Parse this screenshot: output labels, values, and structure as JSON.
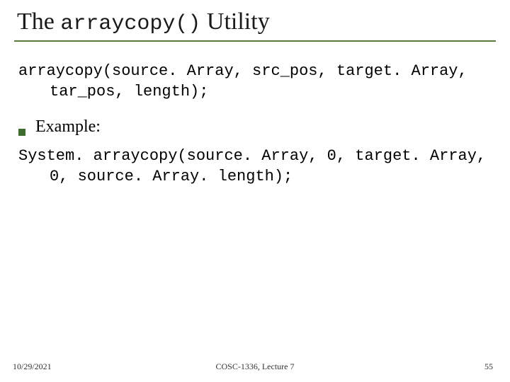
{
  "title": {
    "prefix": "The ",
    "code": "arraycopy()",
    "suffix": " Utility"
  },
  "signature": {
    "line1": "arraycopy(source. Array, src_pos, target. Array,",
    "line2": "tar_pos, length);"
  },
  "bullet": {
    "label": "Example:"
  },
  "example": {
    "line1": "System. arraycopy(source. Array, 0, target. Array,",
    "line2": "0, source. Array. length);"
  },
  "footer": {
    "date": "10/29/2021",
    "course": "COSC-1336, Lecture 7",
    "page": "55"
  }
}
